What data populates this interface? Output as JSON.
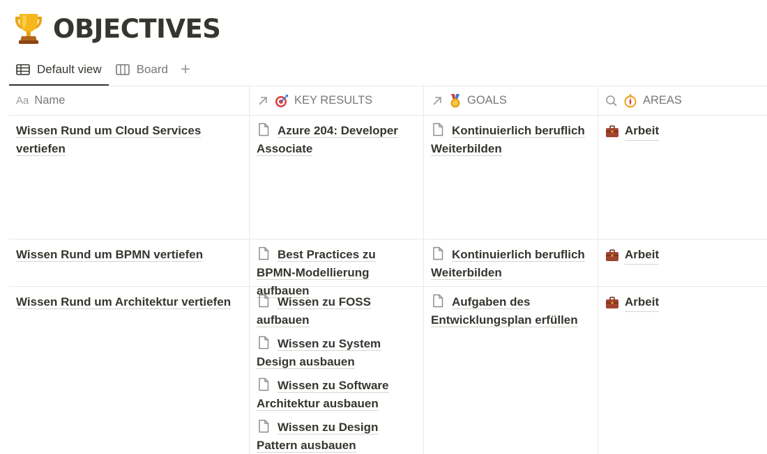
{
  "page": {
    "title": "OBJECTIVES",
    "title_icon": "trophy-icon"
  },
  "tabs": [
    {
      "label": "Default view",
      "icon": "table-icon",
      "active": true
    },
    {
      "label": "Board",
      "icon": "board-icon",
      "active": false
    }
  ],
  "add_tab_label": "+",
  "columns": [
    {
      "prefix": "Aa",
      "label": "Name",
      "icon": "text-property-icon"
    },
    {
      "label": "KEY RESULTS",
      "icon": "relation-arrow-icon",
      "emoji": "target-icon"
    },
    {
      "label": "GOALS",
      "icon": "relation-arrow-icon",
      "emoji": "medal-icon"
    },
    {
      "label": "AREAS",
      "icon": "search-icon",
      "emoji": "compass-icon"
    }
  ],
  "rows": [
    {
      "name": "Wissen Rund um Cloud Services vertiefen",
      "key_results": [
        "Azure 204: Developer Associate"
      ],
      "goals": [
        "Kontinuierlich beruflich Weiterbilden"
      ],
      "areas": [
        "Arbeit"
      ]
    },
    {
      "name": "Wissen Rund um BPMN vertiefen",
      "key_results": [
        "Best Practices zu BPMN-Modellierung aufbauen"
      ],
      "goals": [
        "Kontinuierlich beruflich Weiterbilden"
      ],
      "areas": [
        "Arbeit"
      ]
    },
    {
      "name": "Wissen Rund um Architektur vertiefen",
      "key_results": [
        "Wissen zu FOSS aufbauen",
        "Wissen zu System Design ausbauen",
        "Wissen zu Software Architektur ausbauen",
        "Wissen zu Design Pattern ausbauen"
      ],
      "goals": [
        "Aufgaben des Entwicklungsplan erfüllen"
      ],
      "areas": [
        "Arbeit"
      ]
    }
  ],
  "colors": {
    "text": "#37352f",
    "muted": "#787774",
    "border": "#e9e9e7",
    "briefcase": "#a0432f"
  }
}
